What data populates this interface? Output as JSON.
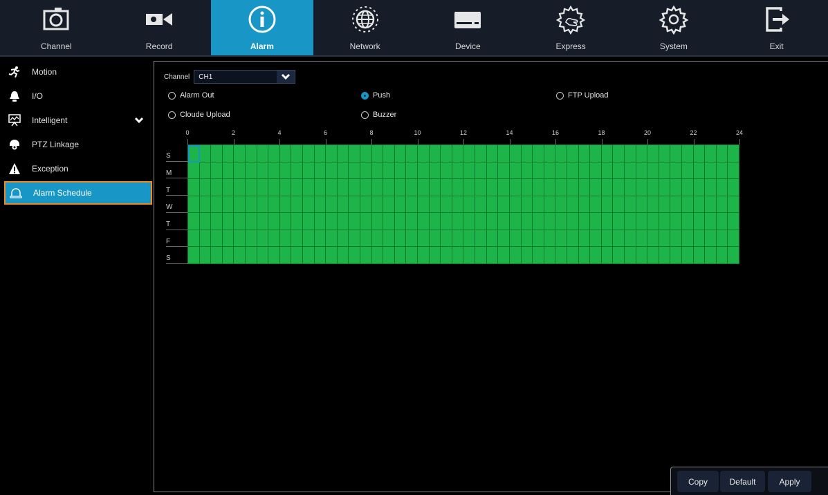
{
  "nav": [
    {
      "label": "Channel",
      "icon": "camera-icon",
      "active": false
    },
    {
      "label": "Record",
      "icon": "video-camera-icon",
      "active": false
    },
    {
      "label": "Alarm",
      "icon": "info-icon",
      "active": true
    },
    {
      "label": "Network",
      "icon": "globe-icon",
      "active": false
    },
    {
      "label": "Device",
      "icon": "hard-drive-icon",
      "active": false
    },
    {
      "label": "Express",
      "icon": "gear-hand-icon",
      "active": false
    },
    {
      "label": "System",
      "icon": "gear-icon",
      "active": false
    },
    {
      "label": "Exit",
      "icon": "exit-icon",
      "active": false
    }
  ],
  "sidebar": {
    "items": [
      {
        "label": "Motion",
        "icon": "running-person-icon"
      },
      {
        "label": "I/O",
        "icon": "bell-icon"
      },
      {
        "label": "Intelligent",
        "icon": "presentation-icon",
        "expandable": true
      },
      {
        "label": "PTZ Linkage",
        "icon": "ptz-camera-icon"
      },
      {
        "label": "Exception",
        "icon": "warning-icon"
      },
      {
        "label": "Alarm Schedule",
        "icon": "alarm-light-icon",
        "selected": true
      }
    ]
  },
  "panel": {
    "channel_label": "Channel",
    "channel_value": "CH1",
    "options": [
      {
        "label": "Alarm Out",
        "checked": false
      },
      {
        "label": "Push",
        "checked": true
      },
      {
        "label": "FTP Upload",
        "checked": false
      },
      {
        "label": "Cloude Upload",
        "checked": false
      },
      {
        "label": "Buzzer",
        "checked": false
      }
    ],
    "hours": [
      "0",
      "2",
      "4",
      "6",
      "8",
      "10",
      "12",
      "14",
      "16",
      "18",
      "20",
      "22",
      "24"
    ],
    "days": [
      "S",
      "M",
      "T",
      "W",
      "T",
      "F",
      "S"
    ]
  },
  "buttons": {
    "copy": "Copy",
    "default": "Default",
    "apply": "Apply"
  },
  "colors": {
    "accent": "#1897c6",
    "selected_border": "#f08a1c",
    "schedule_green": "#1db44a"
  }
}
